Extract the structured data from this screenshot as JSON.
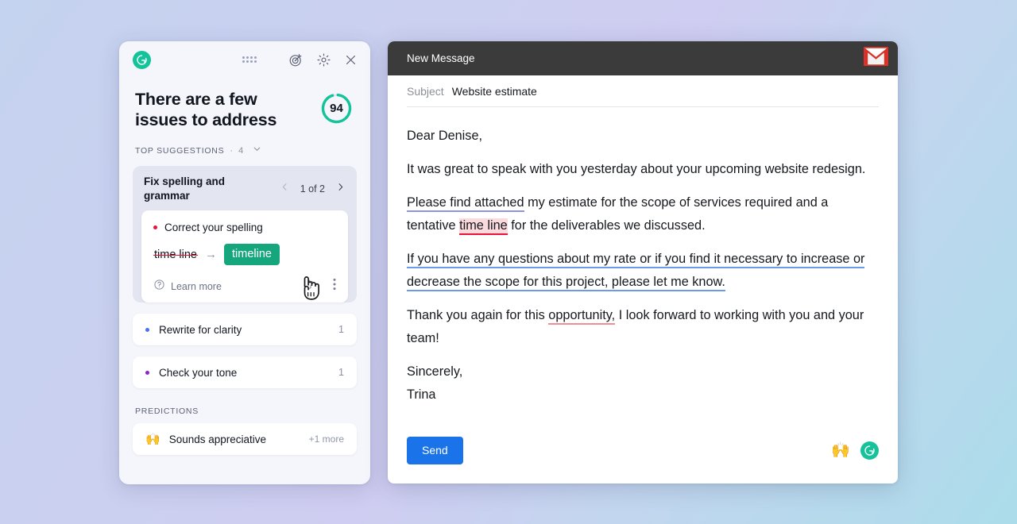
{
  "assistant_panel": {
    "logo_icon": "grammarly-logo",
    "toolbar": {
      "drag_handle_icon": "drag-dots-icon",
      "goals_icon": "goals-target-icon",
      "settings_icon": "gear-icon",
      "close_icon": "close-icon"
    },
    "headline": "There are a few issues to address",
    "score": "94",
    "section": {
      "label": "TOP SUGGESTIONS",
      "separator": "·",
      "count": "4",
      "collapse_icon": "chevron-down-icon"
    },
    "suggestion_card": {
      "title": "Fix spelling and grammar",
      "prev_icon": "chevron-left-icon",
      "pager": "1 of 2",
      "next_icon": "chevron-right-icon",
      "type_label": "Correct your spelling",
      "original": "time line",
      "arrow": "→",
      "replacement": "timeline",
      "learn_more": "Learn more",
      "help_icon": "question-circle-icon",
      "dismiss_icon": "trash-icon",
      "more_icon": "more-vertical-icon"
    },
    "categories": [
      {
        "label": "Rewrite for clarity",
        "count": "1",
        "color": "#4b6ef5"
      },
      {
        "label": "Check your tone",
        "count": "1",
        "color": "#8827c9"
      }
    ],
    "predictions": {
      "label": "PREDICTIONS",
      "items": [
        {
          "emoji": "🙌",
          "label": "Sounds appreciative",
          "extra": "+1 more"
        }
      ]
    }
  },
  "compose_window": {
    "title": "New Message",
    "app_icon": "gmail-icon",
    "subject_label": "Subject",
    "subject_value": "Website estimate",
    "body": {
      "greeting": "Dear Denise,",
      "p1": "It was great to speak with you yesterday about your upcoming website redesign.",
      "p2_part1": "Please find attached",
      "p2_part2": " my estimate for the scope of services required and a tentative ",
      "p2_highlight": "time line",
      "p2_part3": " for the deliverables we discussed.",
      "p3": "If you have any questions about my rate or if you find it necessary to increase or decrease the scope for this project, please let me know.",
      "p4_part1": "Thank you again for this ",
      "p4_highlight": "opportunity,",
      "p4_part2": " I look forward to working with you and your team!",
      "signoff": "Sincerely,",
      "signature": "Trina"
    },
    "send_label": "Send",
    "footer_emoji": "🙌",
    "grammarly_badge_icon": "grammarly-logo"
  },
  "colors": {
    "brand_green": "#15c39a",
    "accept_green": "#15a67d",
    "error_red": "#e8143a",
    "clarity_blue": "#4b6ef5",
    "tone_purple": "#8827c9",
    "send_blue": "#1a73e8",
    "underline_purple": "#8f92de",
    "underline_blue": "#6a9ae8",
    "underline_salmon": "#ef8f95"
  }
}
